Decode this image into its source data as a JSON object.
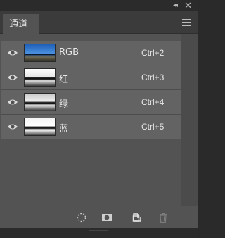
{
  "window": {
    "collapse_label": "◂◂",
    "close_label": "✕"
  },
  "tabs": [
    {
      "label": "通道"
    }
  ],
  "channels": [
    {
      "name": "RGB",
      "shortcut": "Ctrl+2",
      "visible": true
    },
    {
      "name": "红",
      "shortcut": "Ctrl+3",
      "visible": true
    },
    {
      "name": "绿",
      "shortcut": "Ctrl+4",
      "visible": true
    },
    {
      "name": "蓝",
      "shortcut": "Ctrl+5",
      "visible": true
    }
  ],
  "footer_icons": [
    "load-selection-icon",
    "save-selection-mask-icon",
    "new-channel-icon",
    "trash-icon"
  ],
  "colors": {
    "panel": "#535353",
    "row": "#636363",
    "chrome": "#2b2b2b"
  }
}
